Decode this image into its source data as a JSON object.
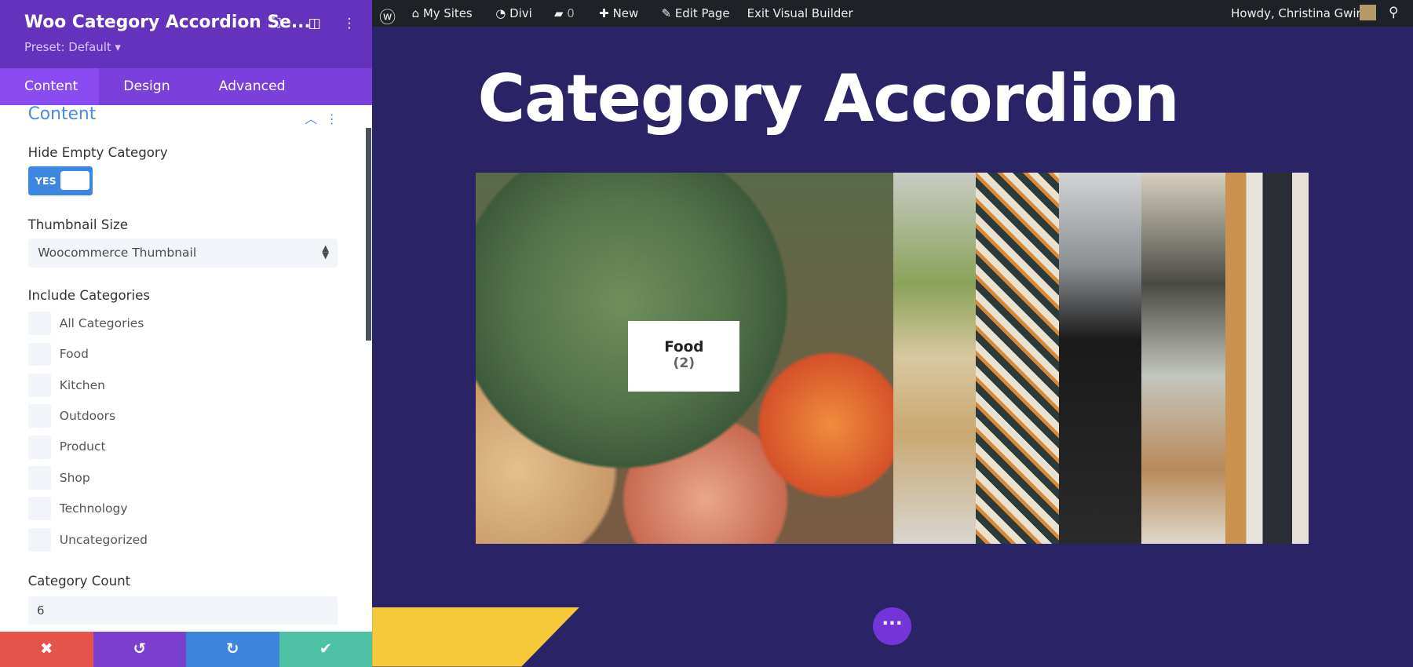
{
  "sidebar": {
    "title": "Woo Category Accordion Se...",
    "preset": "Preset: Default ▾",
    "tabs": [
      "Content",
      "Design",
      "Advanced"
    ],
    "section_title": "Content",
    "hide_empty_label": "Hide Empty Category",
    "hide_empty_value": "YES",
    "thumb_label": "Thumbnail Size",
    "thumb_value": "Woocommerce Thumbnail",
    "include_label": "Include Categories",
    "categories": [
      "All Categories",
      "Food",
      "Kitchen",
      "Outdoors",
      "Product",
      "Shop",
      "Technology",
      "Uncategorized"
    ],
    "count_label": "Category Count",
    "count_value": "6",
    "actions": {
      "cancel": "✖",
      "undo": "↺",
      "redo": "↻",
      "save": "✔"
    },
    "action_colors": [
      "#e5534b",
      "#7b3fd0",
      "#3b86dc",
      "#4fc2a6"
    ]
  },
  "adminbar": {
    "my_sites": "My Sites",
    "divi": "Divi",
    "comments": "0",
    "new": "New",
    "edit": "Edit Page",
    "exit": "Exit Visual Builder",
    "howdy": "Howdy, Christina Gwira"
  },
  "page": {
    "title": "Category Accordion",
    "active_category": "Food",
    "active_count": "(2)"
  }
}
